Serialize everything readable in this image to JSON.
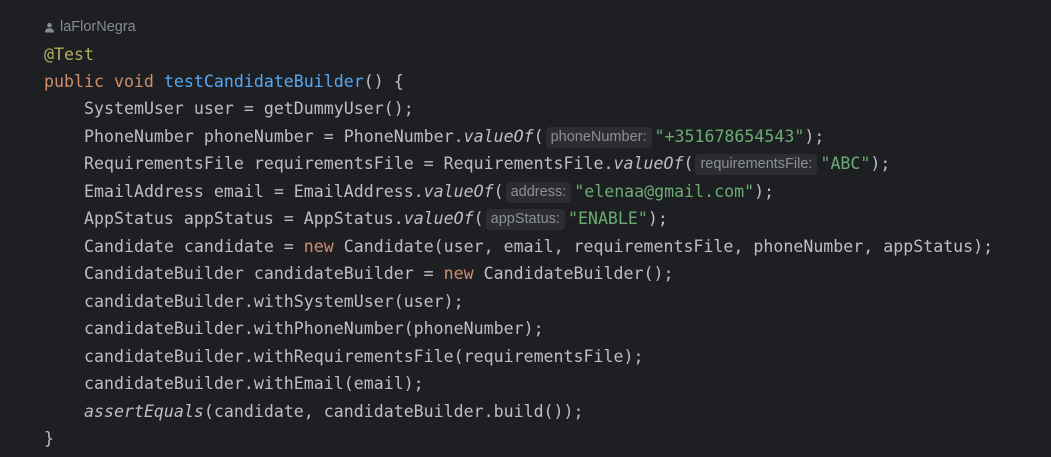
{
  "author": "laFlorNegra",
  "code": {
    "annotation": "@Test",
    "kw_public": "public",
    "kw_void": "void",
    "method_name": "testCandidateBuilder",
    "sig_tail": "() {",
    "l3": "SystemUser user = getDummyUser();",
    "l4a": "PhoneNumber phoneNumber = PhoneNumber.",
    "l4m": "valueOf",
    "l4p": "(",
    "l4hint": "phoneNumber:",
    "l4str": "\"+351678654543\"",
    "l4end": ");",
    "l5a": "RequirementsFile requirementsFile = RequirementsFile.",
    "l5m": "valueOf",
    "l5p": "(",
    "l5hint": "requirementsFile:",
    "l5str": "\"ABC\"",
    "l5end": ");",
    "l6a": "EmailAddress email = EmailAddress.",
    "l6m": "valueOf",
    "l6p": "(",
    "l6hint": "address:",
    "l6str": "\"elenaa@gmail.com\"",
    "l6end": ");",
    "l7a": "AppStatus appStatus = AppStatus.",
    "l7m": "valueOf",
    "l7p": "(",
    "l7hint": "appStatus:",
    "l7str": "\"ENABLE\"",
    "l7end": ");",
    "l8a": "Candidate candidate = ",
    "l8new": "new",
    "l8b": " Candidate(user, email, requirementsFile, phoneNumber, appStatus);",
    "l9a": "CandidateBuilder candidateBuilder = ",
    "l9new": "new",
    "l9b": " CandidateBuilder();",
    "l10": "candidateBuilder.withSystemUser(user);",
    "l11": "candidateBuilder.withPhoneNumber(phoneNumber);",
    "l12": "candidateBuilder.withRequirementsFile(requirementsFile);",
    "l13": "candidateBuilder.withEmail(email);",
    "l14m": "assertEquals",
    "l14b": "(candidate, candidateBuilder.build());",
    "close": "}"
  },
  "colors": {
    "background": "#1e1f22",
    "text": "#bcbec4",
    "keyword": "#cf8e6d",
    "annotation": "#b3ae60",
    "method_decl": "#56a8f5",
    "string": "#6aab73",
    "hint_bg": "#2b2d30",
    "hint_text": "#8c8f95"
  },
  "icons": {
    "author": "person-icon"
  }
}
